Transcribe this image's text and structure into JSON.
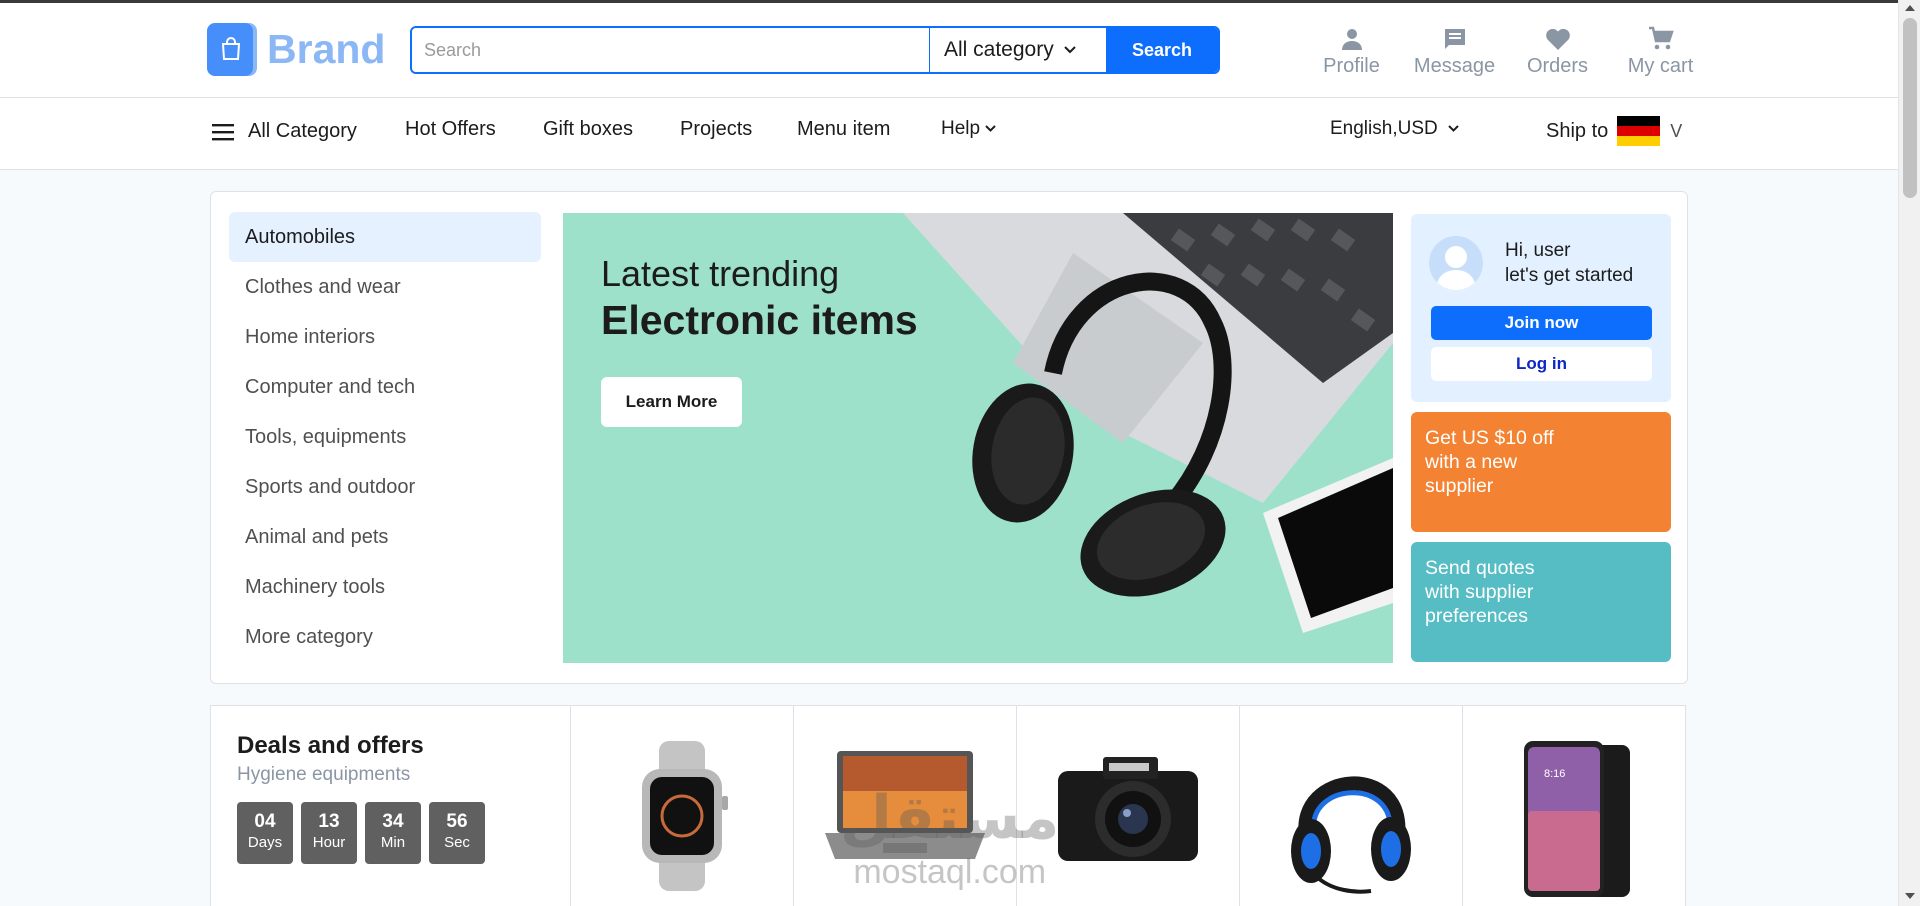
{
  "brand": {
    "name": "Brand"
  },
  "search": {
    "placeholder": "Search",
    "category": "All category",
    "button": "Search"
  },
  "header_actions": [
    {
      "label": "Profile",
      "icon": "person-icon"
    },
    {
      "label": "Message",
      "icon": "message-icon"
    },
    {
      "label": "Orders",
      "icon": "heart-icon"
    },
    {
      "label": "My cart",
      "icon": "cart-icon"
    }
  ],
  "nav": {
    "all_category": "All Category",
    "links": [
      "Hot Offers",
      "Gift boxes",
      "Projects",
      "Menu item",
      "Help"
    ],
    "language": "English,USD",
    "ship_to": "Ship to",
    "ship_suffix": "V"
  },
  "categories": [
    "Automobiles",
    "Clothes and wear",
    "Home interiors",
    "Computer and tech",
    "Tools, equipments",
    "Sports and outdoor",
    "Animal and pets",
    "Machinery tools",
    "More category"
  ],
  "banner": {
    "subtitle": "Latest trending",
    "title": "Electronic items",
    "button": "Learn More"
  },
  "user_box": {
    "greeting_1": "Hi, user",
    "greeting_2": "let's get started",
    "join": "Join now",
    "login": "Log in"
  },
  "promos": {
    "orange": [
      "Get US $10 off",
      "with a new",
      "supplier"
    ],
    "teal": [
      "Send quotes",
      "with supplier",
      "preferences"
    ]
  },
  "deals": {
    "title": "Deals and offers",
    "subtitle": "Hygiene equipments",
    "timer": [
      {
        "value": "04",
        "unit": "Days"
      },
      {
        "value": "13",
        "unit": "Hour"
      },
      {
        "value": "34",
        "unit": "Min"
      },
      {
        "value": "56",
        "unit": "Sec"
      }
    ],
    "products": [
      "smartwatch",
      "laptop",
      "camera",
      "headset",
      "smartphone"
    ]
  },
  "watermark": {
    "line1": "مستقل",
    "line2": "mostaql.com"
  },
  "colors": {
    "primary": "#0d6efd",
    "orange": "#f38332",
    "teal": "#55bdc3",
    "banner_bg": "#9ee1cb",
    "brand_light": "#8cb7f5"
  }
}
